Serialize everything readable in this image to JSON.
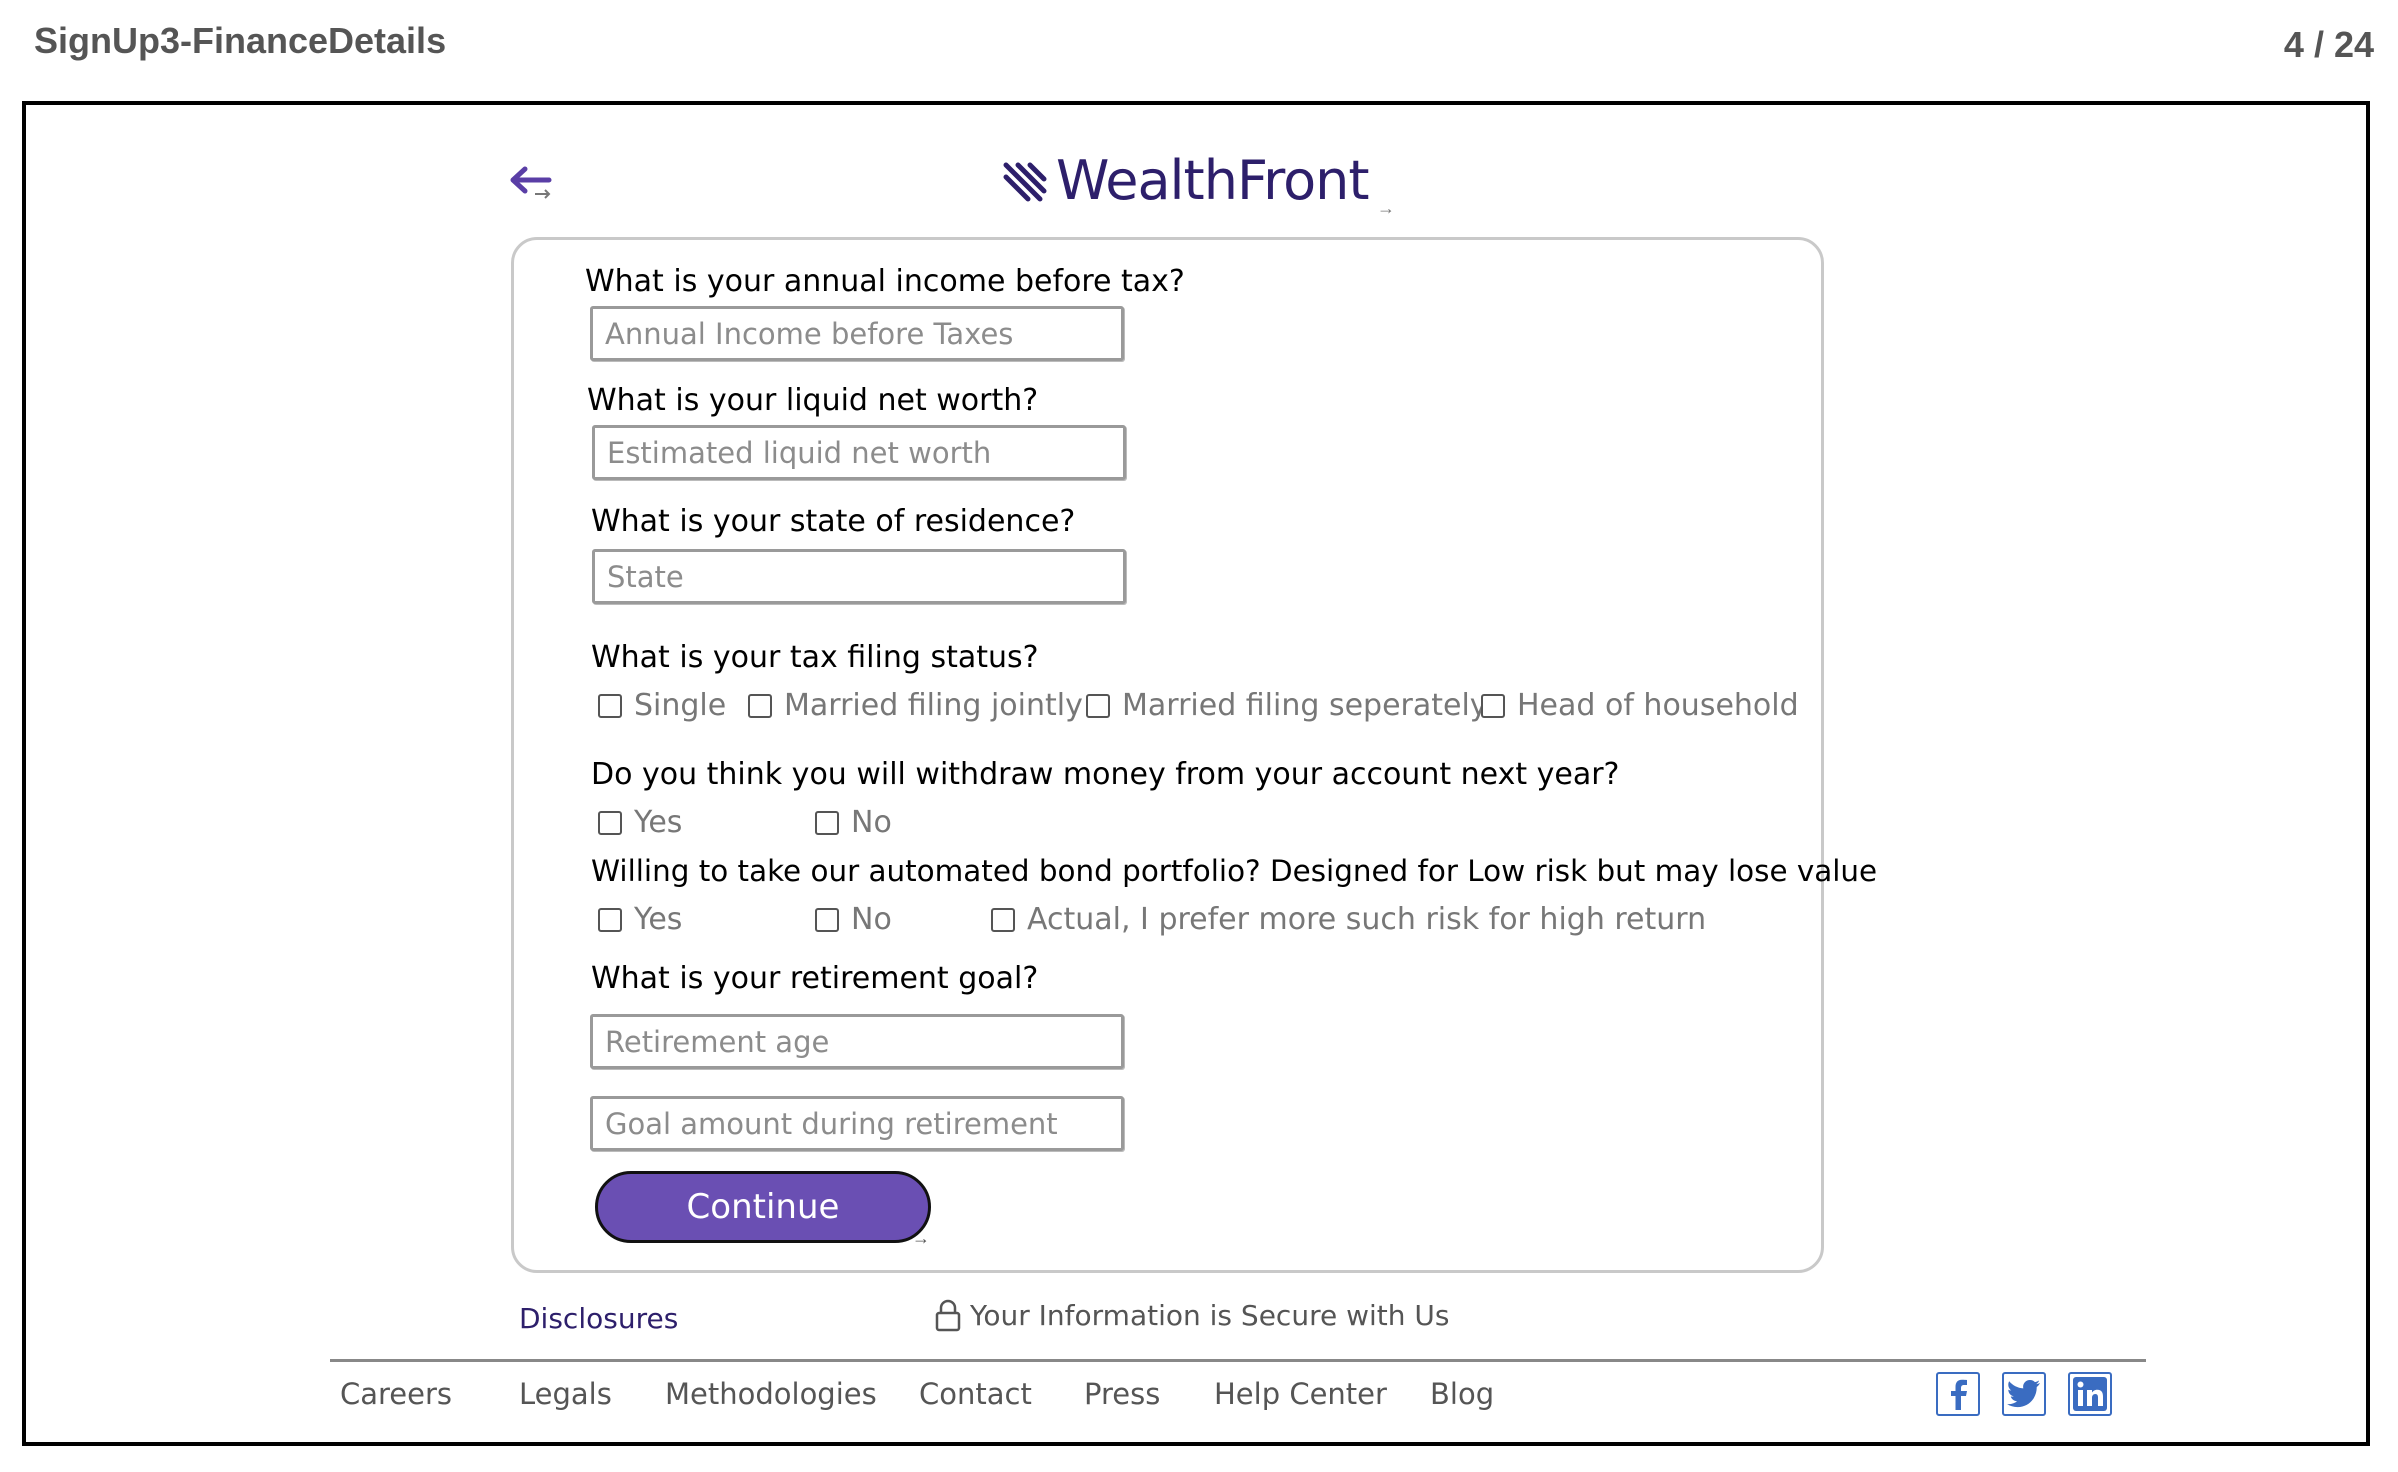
{
  "doc": {
    "title": "SignUp3-FinanceDetails",
    "page": "4 / 24"
  },
  "header": {
    "logo": "WealthFront",
    "arrow": "→"
  },
  "form": {
    "income_question": "What is your annual income before tax?",
    "income_placeholder": "Annual Income before Taxes",
    "networth_question": "What is your liquid net worth?",
    "networth_placeholder": "Estimated liquid net worth",
    "state_question": "What is your state of residence?",
    "state_placeholder": "State",
    "tax_question": "What is your tax filing status?",
    "tax_options": [
      "Single",
      "Married filing jointly",
      "Married filing seperately",
      "Head of household"
    ],
    "withdraw_question": "Do you think you will withdraw money from your account next year?",
    "withdraw_options": [
      "Yes",
      "No"
    ],
    "bond_question": "Willing to take our automated bond portfolio? Designed for Low risk but may lose value",
    "bond_options": [
      "Yes",
      "No",
      "Actual, I prefer more such risk for high return"
    ],
    "retirement_question": "What is your retirement goal?",
    "retirement_age_placeholder": "Retirement age",
    "retirement_goal_placeholder": "Goal amount during retirement",
    "continue_label": "Continue",
    "continue_arrow": "→"
  },
  "below_card": {
    "disclosures": "Disclosures",
    "secure": "Your Information is Secure with Us"
  },
  "footer": {
    "links": [
      "Careers",
      "Legals",
      "Methodologies",
      "Contact",
      "Press",
      "Help Center",
      "Blog"
    ],
    "social": [
      "facebook-icon",
      "twitter-icon",
      "linkedin-icon"
    ]
  },
  "colors": {
    "brand": "#2d1f6b",
    "button": "#6a4fb3",
    "social": "#3a6cc1"
  }
}
